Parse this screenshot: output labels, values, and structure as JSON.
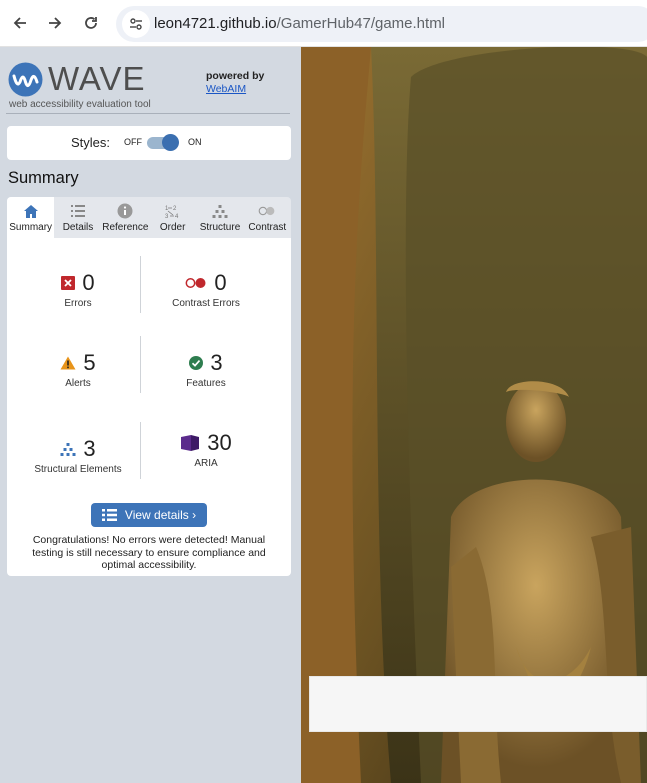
{
  "browser": {
    "url_host": "leon4721.github.io",
    "url_path": "/GamerHub47/game.html"
  },
  "wave": {
    "brand": "WAVE",
    "tagline": "web accessibility evaluation tool",
    "powered_by": "powered by",
    "webaim": "WebAIM",
    "styles_label": "Styles:",
    "styles_off": "OFF",
    "styles_on": "ON",
    "summary_heading": "Summary",
    "tabs": [
      {
        "label": "Summary",
        "icon": "home-icon"
      },
      {
        "label": "Details",
        "icon": "list-icon"
      },
      {
        "label": "Reference",
        "icon": "info-icon"
      },
      {
        "label": "Order",
        "icon": "order-icon"
      },
      {
        "label": "Structure",
        "icon": "structure-icon"
      },
      {
        "label": "Contrast",
        "icon": "contrast-icon"
      }
    ],
    "stats": {
      "errors": {
        "count": "0",
        "label": "Errors"
      },
      "contrast_errors": {
        "count": "0",
        "label": "Contrast Errors"
      },
      "alerts": {
        "count": "5",
        "label": "Alerts"
      },
      "features": {
        "count": "3",
        "label": "Features"
      },
      "structural": {
        "count": "3",
        "label": "Structural Elements"
      },
      "aria": {
        "count": "30",
        "label": "ARIA"
      }
    },
    "view_details": "View details ›",
    "congrats": "Congratulations! No errors were detected! Manual testing is still necessary to ensure compliance and optimal accessibility."
  },
  "colors": {
    "accent": "#3d74b8",
    "error": "#c0282d",
    "alert": "#e8941a",
    "feature": "#2e7d4f",
    "structure": "#3d74b8",
    "aria": "#5b2b8c"
  }
}
